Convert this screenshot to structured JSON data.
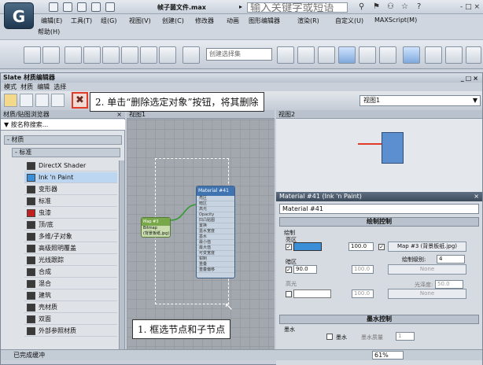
{
  "app": {
    "logo": "G",
    "file_title": "帧子菌文件.max",
    "search_placeholder": "输入关键字或短语",
    "window_controls": "- □ ×"
  },
  "menus": [
    "编辑(E)",
    "工具(T)",
    "组(G)",
    "视图(V)",
    "创建(C)",
    "修改器",
    "动画",
    "图形编辑器",
    "渲染(R)",
    "自定义(U)",
    "MAXScript(M)",
    "帮助(H)"
  ],
  "toolbar": {
    "selection_filter": "创建选择集"
  },
  "slate": {
    "title": "Slate 材质编辑器",
    "menus": [
      "模式",
      "材质",
      "编辑",
      "选择"
    ],
    "view_dropdown": "视图1",
    "browser_title": "材质/贴图浏览器",
    "search_label": "按名称搜索...",
    "group_materials": "- 材质",
    "group_standard": "- 标准",
    "materials": [
      {
        "name": "DirectX Shader",
        "color": "#3a3a3a"
      },
      {
        "name": "Ink 'n Paint",
        "color": "#3b8fd6"
      },
      {
        "name": "变形器",
        "color": "#3a3a3a"
      },
      {
        "name": "标准",
        "color": "#3a3a3a"
      },
      {
        "name": "虫漆",
        "color": "#c0201e"
      },
      {
        "name": "顶/底",
        "color": "#3a3a3a"
      },
      {
        "name": "多维/子对象",
        "color": "#3a3a3a"
      },
      {
        "name": "高级照明覆盖",
        "color": "#3a3a3a"
      },
      {
        "name": "光线跟踪",
        "color": "#3a3a3a"
      },
      {
        "name": "合成",
        "color": "#3a3a3a"
      },
      {
        "name": "混合",
        "color": "#3a3a3a"
      },
      {
        "name": "建筑",
        "color": "#3a3a3a"
      },
      {
        "name": "壳材质",
        "color": "#3a3a3a"
      },
      {
        "name": "双面",
        "color": "#3a3a3a"
      },
      {
        "name": "外部参照材质",
        "color": "#3a3a3a"
      }
    ],
    "view1_tab": "视图1",
    "view2_tab": "视图2",
    "node_title": "Material #41",
    "node_sub": "Ink'n Paint",
    "node_rows": [
      "亮区",
      "暗区",
      "高光",
      "Opacity",
      "凹凸贴图",
      "置换",
      "墨水宽度",
      "墨水",
      "最小值",
      "最大值",
      "可变宽度",
      "钳制",
      "重叠",
      "重叠偏移",
      "延伸",
      "轮廓",
      "相交偏移",
      "平滑组",
      "材质ID",
      "仅相邻面",
      "交叉偏移",
      "下方偏移",
      "映射"
    ],
    "small_node_title": "Map #3",
    "small_node_sub": "Bitmap",
    "small_node_file": "(背景板纸.jpg)",
    "param_title": "Material #41 (Ink 'n Paint)",
    "material_name": "Material #41",
    "rollout_paint": "绘制控制",
    "label_paint": "绘制",
    "label_lit": "亮区",
    "lit_value": "100.0",
    "map_button": "Map #3 (背景板纸.jpg)",
    "label_levels": "绘制级别:",
    "levels_value": "4",
    "label_shaded": "暗区",
    "shaded_value": "90.0",
    "shaded_map_value": "100.0",
    "none_1": "None",
    "label_highlight": "高光",
    "gloss_label": "光泽度:",
    "gloss_value": "50.0",
    "highlight_value": "100.0",
    "none_2": "None",
    "rollout_ink": "墨水控制",
    "label_ink": "墨水",
    "label_ink_check": "墨水",
    "label_ink_quality": "墨水质量",
    "ink_quality_value": "1",
    "status_text": "已完成缓冲",
    "zoom": "61%"
  },
  "callouts": {
    "step2": "2. 单击“删除选定对象”按钮，将其删除",
    "step1": "1. 框选节点和子节点"
  },
  "colors": {
    "highlight_red": "#e23a28",
    "node_blue": "#3f74b1",
    "preview_blue": "#5b8fd0"
  }
}
